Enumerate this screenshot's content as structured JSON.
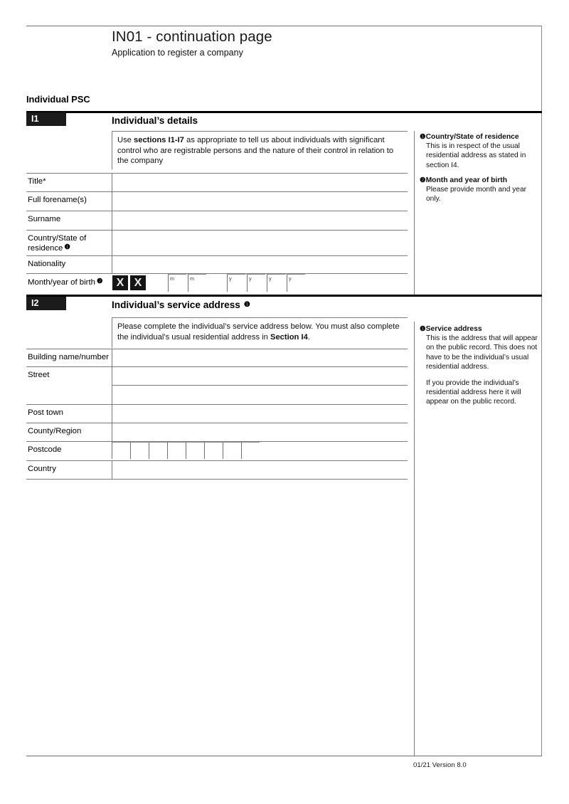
{
  "document": {
    "title": "IN01 - continuation page",
    "subtitle": "Application to register a company",
    "group_heading": "Individual PSC",
    "footer_version": "01/21 Version 8.0"
  },
  "section_i1": {
    "tab": "I1",
    "title": "Individual’s details",
    "instruction_prefix": "Use ",
    "instruction_bold": "sections I1-I7",
    "instruction_suffix": "  as appropriate to tell us about individuals with significant control who are registrable persons and the nature of their control in relation to the company",
    "fields": [
      {
        "label": "Title*",
        "note_ref": ""
      },
      {
        "label": "Full forename(s)",
        "note_ref": ""
      },
      {
        "label": "Surname",
        "note_ref": ""
      },
      {
        "label": "Country/State of residence",
        "note_ref": "❶"
      },
      {
        "label": "Nationality",
        "note_ref": ""
      }
    ],
    "dob": {
      "label": "Month/year of birth",
      "note_ref": "❷",
      "x_marks": [
        "X",
        "X"
      ],
      "month_hints": [
        "m",
        "m"
      ],
      "year_hints": [
        "y",
        "y",
        "y",
        "y"
      ]
    },
    "notes": [
      {
        "marker": "❶",
        "title": "Country/State of residence",
        "body": "This is in respect of the usual residential address as stated in section I4."
      },
      {
        "marker": "❷",
        "title": "Month and year of birth",
        "body": "Please provide month and year only."
      }
    ]
  },
  "section_i2": {
    "tab": "I2",
    "title": "Individual’s service address",
    "title_note_ref": "❶",
    "instruction_prefix": "Please complete the individual’s service address below. You must also complete the individual’s usual residential address in ",
    "instruction_bold": "Section I4",
    "instruction_suffix": ".",
    "fields": [
      {
        "label": "Building name/number"
      },
      {
        "label": "Street"
      },
      {
        "label": ""
      },
      {
        "label": "Post town"
      },
      {
        "label": "County/Region"
      },
      {
        "label": "Postcode"
      },
      {
        "label": "Country"
      }
    ],
    "postcode_box_count": 8,
    "notes": [
      {
        "marker": "❶",
        "title": "Service address",
        "body1": "This is the address that will appear on the public record. This does not have to be the individual’s usual residential address.",
        "body2": "If you provide the individual’s residential address here it will appear on the public record."
      }
    ]
  }
}
